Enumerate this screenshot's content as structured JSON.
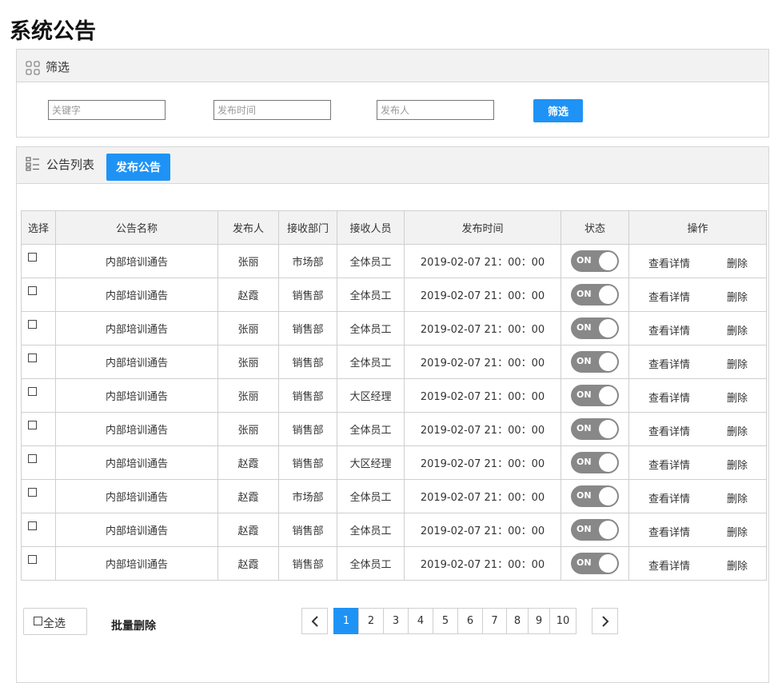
{
  "page": {
    "title": "系统公告"
  },
  "filter": {
    "header": "筛选",
    "keyword_placeholder": "关键字",
    "time_placeholder": "发布时间",
    "publisher_placeholder": "发布人",
    "button": "筛选"
  },
  "list": {
    "header": "公告列表",
    "publish_button": "发布公告",
    "columns": [
      "选择",
      "公告名称",
      "发布人",
      "接收部门",
      "接收人员",
      "发布时间",
      "状态",
      "操作"
    ],
    "rows": [
      {
        "name": "内部培训通告",
        "publisher": "张丽",
        "dept": "市场部",
        "receiver": "全体员工",
        "time": "2019-02-07 21：00：00",
        "status": "ON",
        "detail": "查看详情",
        "delete": "删除"
      },
      {
        "name": "内部培训通告",
        "publisher": "赵霞",
        "dept": "销售部",
        "receiver": "全体员工",
        "time": "2019-02-07 21：00：00",
        "status": "ON",
        "detail": "查看详情",
        "delete": "删除"
      },
      {
        "name": "内部培训通告",
        "publisher": "张丽",
        "dept": "销售部",
        "receiver": "全体员工",
        "time": "2019-02-07 21：00：00",
        "status": "ON",
        "detail": "查看详情",
        "delete": "删除"
      },
      {
        "name": "内部培训通告",
        "publisher": "张丽",
        "dept": "销售部",
        "receiver": "全体员工",
        "time": "2019-02-07 21：00：00",
        "status": "ON",
        "detail": "查看详情",
        "delete": "删除"
      },
      {
        "name": "内部培训通告",
        "publisher": "张丽",
        "dept": "销售部",
        "receiver": "大区经理",
        "time": "2019-02-07 21：00：00",
        "status": "ON",
        "detail": "查看详情",
        "delete": "删除"
      },
      {
        "name": "内部培训通告",
        "publisher": "张丽",
        "dept": "销售部",
        "receiver": "全体员工",
        "time": "2019-02-07 21：00：00",
        "status": "ON",
        "detail": "查看详情",
        "delete": "删除"
      },
      {
        "name": "内部培训通告",
        "publisher": "赵霞",
        "dept": "销售部",
        "receiver": "大区经理",
        "time": "2019-02-07 21：00：00",
        "status": "ON",
        "detail": "查看详情",
        "delete": "删除"
      },
      {
        "name": "内部培训通告",
        "publisher": "赵霞",
        "dept": "市场部",
        "receiver": "全体员工",
        "time": "2019-02-07 21：00：00",
        "status": "ON",
        "detail": "查看详情",
        "delete": "删除"
      },
      {
        "name": "内部培训通告",
        "publisher": "赵霞",
        "dept": "销售部",
        "receiver": "全体员工",
        "time": "2019-02-07 21：00：00",
        "status": "ON",
        "detail": "查看详情",
        "delete": "删除"
      },
      {
        "name": "内部培训通告",
        "publisher": "赵霞",
        "dept": "销售部",
        "receiver": "全体员工",
        "time": "2019-02-07 21：00：00",
        "status": "ON",
        "detail": "查看详情",
        "delete": "删除"
      }
    ]
  },
  "footer": {
    "select_all": "全选",
    "batch_delete": "批量删除"
  },
  "pagination": {
    "pages": [
      "1",
      "2",
      "3",
      "4",
      "5",
      "6",
      "7",
      "8",
      "9",
      "10"
    ],
    "current": "1"
  },
  "icons": {
    "filter_header": "grid-icon",
    "list_header": "list-icon",
    "prev": "chevron-left-icon",
    "next": "chevron-right-icon"
  },
  "colors": {
    "accent": "#1e93f5",
    "toggle": "#888888",
    "header_bg": "#f2f2f2"
  }
}
